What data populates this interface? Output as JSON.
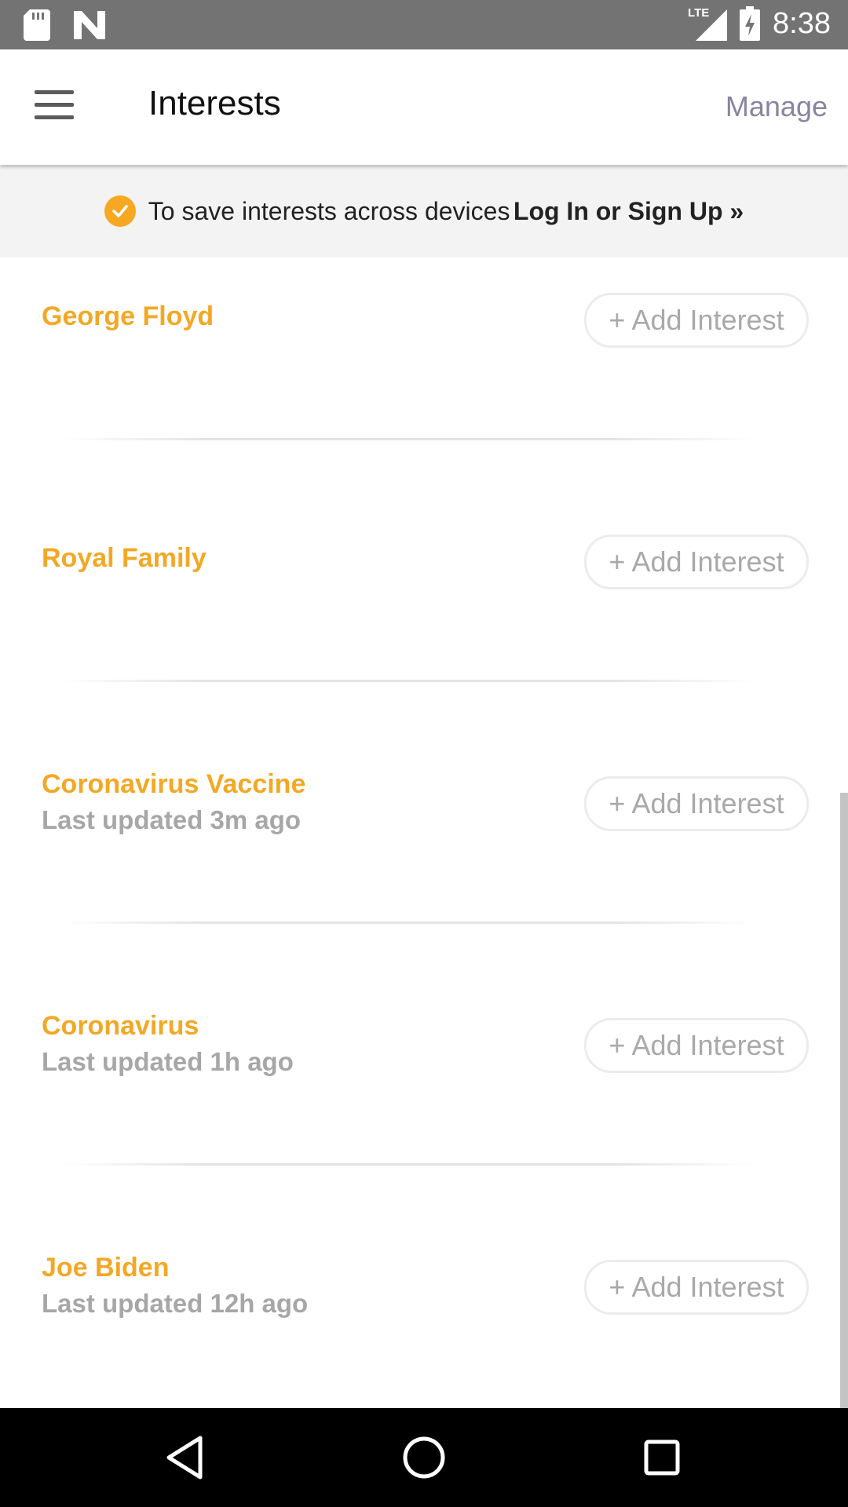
{
  "status_bar": {
    "time": "8:38",
    "network": "LTE",
    "icons": [
      "sd-card-icon",
      "n-logo-icon",
      "lte-signal-icon",
      "battery-charging-icon"
    ]
  },
  "app_bar": {
    "title": "Interests",
    "menu_icon": "hamburger-menu-icon",
    "manage_label": "Manage"
  },
  "banner": {
    "icon": "check-circle-icon",
    "text": "To save interests across devices",
    "link": "Log In or Sign Up »"
  },
  "interests": [
    {
      "title": "George Floyd",
      "updated": "",
      "button": "+ Add Interest"
    },
    {
      "title": "Royal Family",
      "updated": "",
      "button": "+ Add Interest"
    },
    {
      "title": "Coronavirus Vaccine",
      "updated": "Last updated 3m ago",
      "button": "+ Add Interest"
    },
    {
      "title": "Coronavirus",
      "updated": "Last updated 1h ago",
      "button": "+ Add Interest"
    },
    {
      "title": "Joe Biden",
      "updated": "Last updated 12h ago",
      "button": "+ Add Interest"
    }
  ],
  "nav_bar": {
    "icons": [
      "back-triangle-icon",
      "home-circle-icon",
      "recents-square-icon"
    ]
  },
  "colors": {
    "accent": "#f3a825",
    "status_bar": "#737373",
    "manage": "#8a84a0",
    "banner_bg": "#f3f3f3",
    "subtext": "#a7a7a7"
  }
}
